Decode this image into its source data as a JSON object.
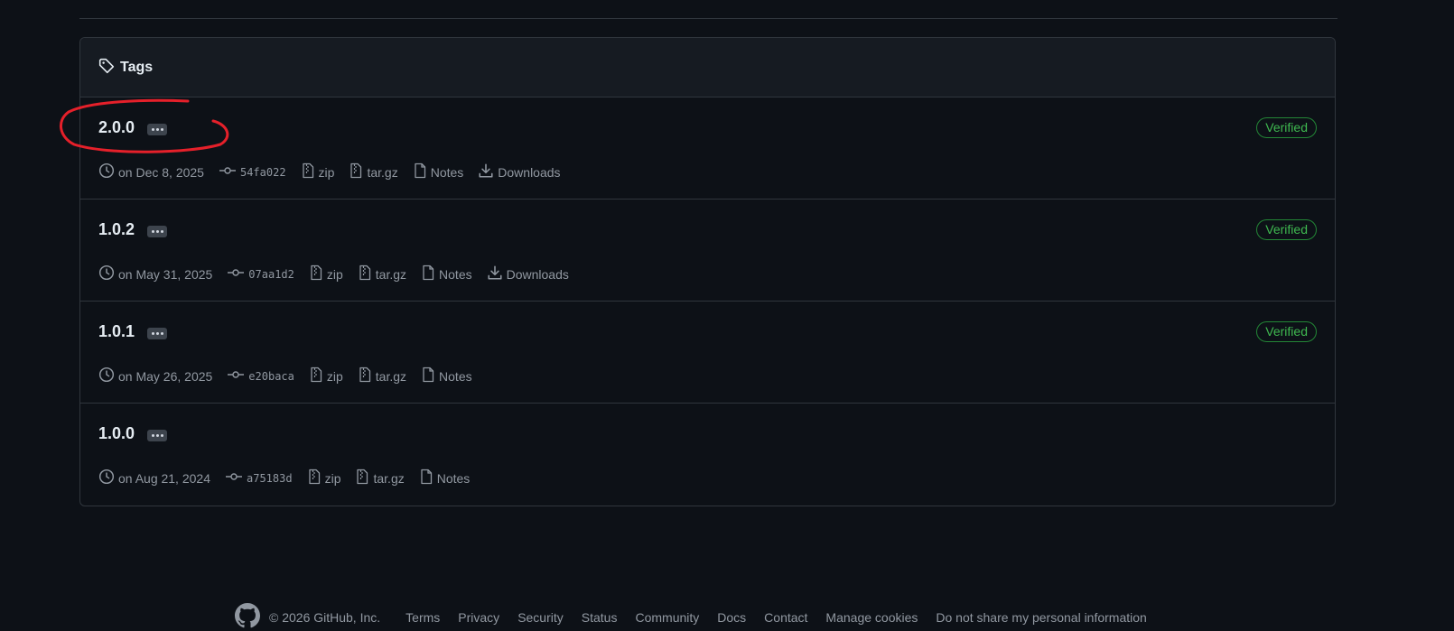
{
  "tags": {
    "title": "Tags",
    "items": [
      {
        "name": "2.0.0",
        "verified": "Verified",
        "date": "on Dec 8, 2025",
        "sha": "54fa022",
        "zip": "zip",
        "targz": "tar.gz",
        "notes": "Notes",
        "downloads": "Downloads"
      },
      {
        "name": "1.0.2",
        "verified": "Verified",
        "date": "on May 31, 2025",
        "sha": "07aa1d2",
        "zip": "zip",
        "targz": "tar.gz",
        "notes": "Notes",
        "downloads": "Downloads"
      },
      {
        "name": "1.0.1",
        "verified": "Verified",
        "date": "on May 26, 2025",
        "sha": "e20baca",
        "zip": "zip",
        "targz": "tar.gz",
        "notes": "Notes"
      },
      {
        "name": "1.0.0",
        "date": "on Aug 21, 2024",
        "sha": "a75183d",
        "zip": "zip",
        "targz": "tar.gz",
        "notes": "Notes"
      }
    ]
  },
  "footer": {
    "copyright": "© 2026 GitHub, Inc.",
    "links": [
      "Terms",
      "Privacy",
      "Security",
      "Status",
      "Community",
      "Docs",
      "Contact",
      "Manage cookies",
      "Do not share my personal information"
    ]
  },
  "icons": {
    "tag": "tag-icon",
    "clock": "clock-icon",
    "commit": "commit-icon",
    "zip": "file-zip-icon",
    "notes": "file-icon",
    "download": "download-icon",
    "github": "github-logo-icon"
  },
  "colors": {
    "background": "#0d1117",
    "header_bg": "#161b22",
    "border": "#30363d",
    "verified": "#3fb950",
    "annotation": "#e5202a"
  }
}
